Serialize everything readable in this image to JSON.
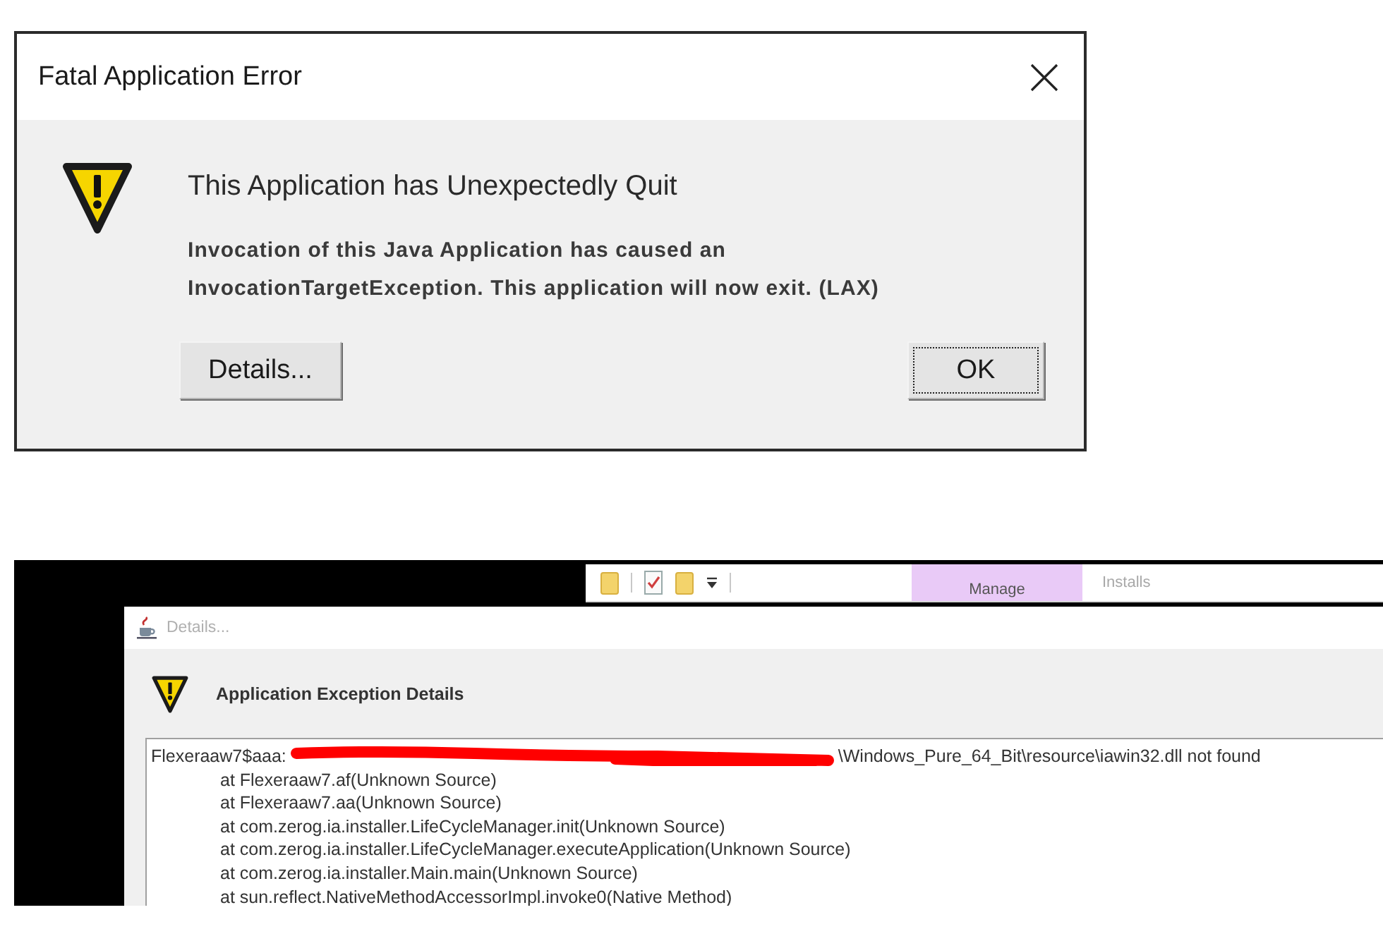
{
  "error_dialog": {
    "title": "Fatal Application Error",
    "heading": "This Application has Unexpectedly Quit",
    "message_lines": [
      "Invocation of this Java Application has caused an",
      "InvocationTargetException. This application will now exit. (LAX)"
    ],
    "buttons": [
      {
        "label": "Details...",
        "focused": false
      },
      {
        "label": "OK",
        "focused": true
      }
    ]
  },
  "details_screenshot": {
    "explorer": {
      "context_tab": "Manage",
      "title": "Installs"
    },
    "details_window": {
      "title": "Details...",
      "active": false,
      "heading": "Application Exception Details",
      "trace": {
        "first_line": {
          "prefix": "Flexeraaw7$aaa:",
          "redacted": true,
          "suffix": "\\Windows_Pure_64_Bit\\resource\\iawin32.dll not found"
        },
        "frames": [
          "at Flexeraaw7.af(Unknown Source)",
          "at Flexeraaw7.aa(Unknown Source)",
          "at com.zerog.ia.installer.LifeCycleManager.init(Unknown Source)",
          "at com.zerog.ia.installer.LifeCycleManager.executeApplication(Unknown Source)",
          "at com.zerog.ia.installer.Main.main(Unknown Source)",
          "at sun.reflect.NativeMethodAccessorImpl.invoke0(Native Method)"
        ]
      }
    }
  }
}
